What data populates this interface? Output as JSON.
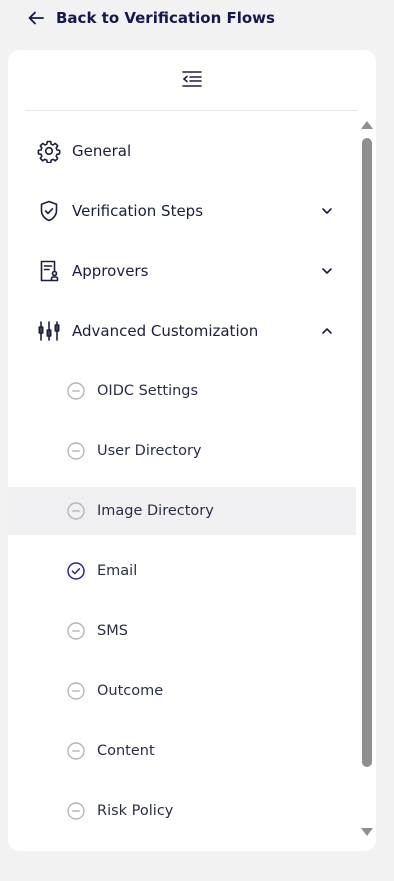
{
  "header": {
    "back_label": "Back to Verification Flows",
    "back_icon": "arrow-left-icon"
  },
  "sidebar": {
    "collapse_icon": "collapse-menu-icon",
    "items": [
      {
        "label": "General",
        "icon": "gear-icon"
      },
      {
        "label": "Verification Steps",
        "icon": "shield-check-icon",
        "expandable": true,
        "expanded": false
      },
      {
        "label": "Approvers",
        "icon": "approver-document-icon",
        "expandable": true,
        "expanded": false
      },
      {
        "label": "Advanced Customization",
        "icon": "sliders-icon",
        "expandable": true,
        "expanded": true,
        "children": [
          {
            "label": "OIDC Settings",
            "status": "incomplete"
          },
          {
            "label": "User Directory",
            "status": "incomplete"
          },
          {
            "label": "Image Directory",
            "status": "incomplete",
            "selected": true
          },
          {
            "label": "Email",
            "status": "complete"
          },
          {
            "label": "SMS",
            "status": "incomplete"
          },
          {
            "label": "Outcome",
            "status": "incomplete"
          },
          {
            "label": "Content",
            "status": "incomplete"
          },
          {
            "label": "Risk Policy",
            "status": "incomplete"
          }
        ]
      }
    ]
  },
  "colors": {
    "brand_dark": "#14184a",
    "text": "#1b1f3b",
    "status_complete": "#2b2a8c",
    "status_incomplete": "#b5b5bb",
    "selected_bg": "#f0f0f2",
    "scrollbar": "#8f8f8f"
  }
}
